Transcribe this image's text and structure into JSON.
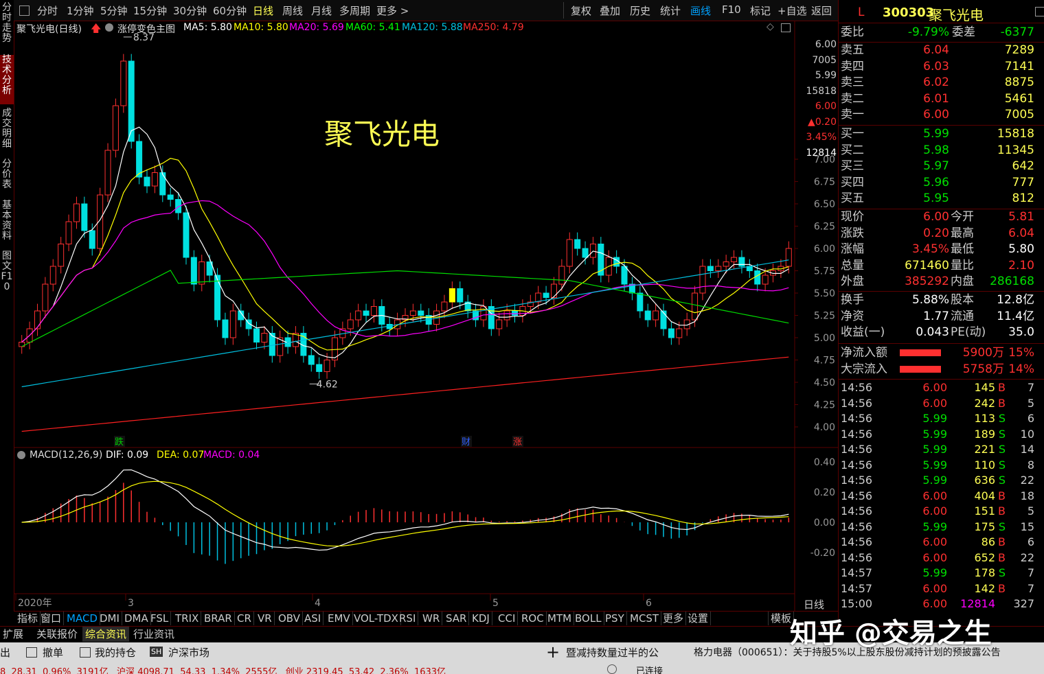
{
  "left_tabs": [
    {
      "label": "分时走势",
      "active": false
    },
    {
      "label": "技术分析",
      "active": true
    },
    {
      "label": "成交明细",
      "active": false
    },
    {
      "label": "分价表",
      "active": false
    },
    {
      "label": "基本资料",
      "active": false
    },
    {
      "label": "图文F10",
      "active": false
    }
  ],
  "toolbar": {
    "periods": [
      "分时",
      "1分钟",
      "5分钟",
      "15分钟",
      "30分钟",
      "60分钟",
      "日线",
      "周线",
      "月线",
      "多周期",
      "更多 >"
    ],
    "active_period": "日线",
    "actions": [
      "复权",
      "叠加",
      "历史",
      "统计",
      "画线",
      "F10",
      "标记",
      "+自选",
      "返回"
    ],
    "active_action": "画线"
  },
  "chart": {
    "title": "聚飞光电(日线)",
    "main_indicator": "涨停变色主图",
    "ma": [
      {
        "label": "MA5: 5.80",
        "color": "#ffffff"
      },
      {
        "label": "MA10: 5.80",
        "color": "#ffff00"
      },
      {
        "label": "MA20: 5.69",
        "color": "#ff00ff"
      },
      {
        "label": "MA60: 5.41",
        "color": "#00ff00"
      },
      {
        "label": "MA120: 5.88",
        "color": "#00c0e0"
      },
      {
        "label": "MA250: 4.79",
        "color": "#ff3030"
      }
    ],
    "watermark_name": "聚飞光电",
    "high_label": "8.37",
    "low_label": "4.62",
    "price_axis": [
      "7.00",
      "6.75",
      "6.50",
      "6.25",
      "6.00",
      "5.75",
      "5.50",
      "5.25",
      "5.00",
      "4.75",
      "4.50",
      "4.25",
      "4.00"
    ],
    "cursor_info": [
      {
        "text": "6.00",
        "color": "#cccccc"
      },
      {
        "text": "7005",
        "color": "#cccccc"
      },
      {
        "text": "5.99",
        "color": "#cccccc"
      },
      {
        "text": "15818",
        "color": "#cccccc"
      },
      {
        "text": "6.00",
        "color": "#ff3030"
      },
      {
        "text": "▲0.20",
        "color": "#ff3030"
      },
      {
        "text": "3.45%",
        "color": "#ff3030"
      },
      {
        "text": "12814",
        "color": "#ffffff"
      }
    ],
    "date_axis": [
      {
        "label": "2020年",
        "pos": "start"
      },
      {
        "label": "3",
        "pos": "mar"
      },
      {
        "label": "4",
        "pos": "apr"
      },
      {
        "label": "5",
        "pos": "may"
      },
      {
        "label": "6",
        "pos": "jun"
      }
    ],
    "period_label": "日线",
    "events": [
      {
        "label": "跌",
        "color": "#00cc00"
      },
      {
        "label": "财",
        "color": "#3060ff"
      },
      {
        "label": "涨",
        "color": "#ff3030"
      }
    ]
  },
  "macd": {
    "title": "MACD(12,26,9)",
    "dif": "DIF: 0.09",
    "dea": "DEA: 0.07",
    "macd": "MACD: 0.04",
    "axis": [
      "0.40",
      "0.20",
      "0.00",
      "-0.20"
    ]
  },
  "indicators": [
    "指标",
    "窗口",
    "MACD",
    "DMI",
    "DMA",
    "FSL",
    "TRIX",
    "BRAR",
    "CR",
    "VR",
    "OBV",
    "ASI",
    "EMV",
    "VOL-TDX",
    "RSI",
    "WR",
    "SAR",
    "KDJ",
    "CCI",
    "ROC",
    "MTM",
    "BOLL",
    "PSY",
    "MCST",
    "更多",
    "设置"
  ],
  "active_indicator": "MACD",
  "template_label": "模板",
  "quote": {
    "code": "300303",
    "name": "聚飞光电",
    "flag": "L",
    "weibi_label": "委比",
    "weibi": "-9.79%",
    "weicha_label": "委差",
    "weicha": "-6377",
    "asks": [
      {
        "label": "卖五",
        "price": "6.04",
        "vol": "7289"
      },
      {
        "label": "卖四",
        "price": "6.03",
        "vol": "7141"
      },
      {
        "label": "卖三",
        "price": "6.02",
        "vol": "8875"
      },
      {
        "label": "卖二",
        "price": "6.01",
        "vol": "5461"
      },
      {
        "label": "卖一",
        "price": "6.00",
        "vol": "7005"
      }
    ],
    "bids": [
      {
        "label": "买一",
        "price": "5.99",
        "vol": "15818"
      },
      {
        "label": "买二",
        "price": "5.98",
        "vol": "11345"
      },
      {
        "label": "买三",
        "price": "5.97",
        "vol": "642"
      },
      {
        "label": "买四",
        "price": "5.96",
        "vol": "777"
      },
      {
        "label": "买五",
        "price": "5.95",
        "vol": "812"
      }
    ],
    "stats1": [
      {
        "l1": "现价",
        "v1": "6.00",
        "c1": "#ff3030",
        "l2": "今开",
        "v2": "5.81",
        "c2": "#ff3030"
      },
      {
        "l1": "涨跌",
        "v1": "0.20",
        "c1": "#ff3030",
        "l2": "最高",
        "v2": "6.04",
        "c2": "#ff3030"
      },
      {
        "l1": "涨幅",
        "v1": "3.45%",
        "c1": "#ff3030",
        "l2": "最低",
        "v2": "5.80",
        "c2": "#ffffff"
      },
      {
        "l1": "总量",
        "v1": "671460",
        "c1": "#ffff54",
        "l2": "量比",
        "v2": "2.10",
        "c2": "#ff3030"
      },
      {
        "l1": "外盘",
        "v1": "385292",
        "c1": "#ff3030",
        "l2": "内盘",
        "v2": "286168",
        "c2": "#00e000"
      }
    ],
    "stats2": [
      {
        "l1": "换手",
        "v1": "5.88%",
        "l2": "股本",
        "v2": "12.8亿"
      },
      {
        "l1": "净资",
        "v1": "1.77",
        "l2": "流通",
        "v2": "11.4亿"
      },
      {
        "l1": "收益(一)",
        "v1": "0.043",
        "l2": "PE(动)",
        "v2": "35.0"
      }
    ],
    "flows": [
      {
        "label": "净流入额",
        "amount": "5900万",
        "pct": "15%"
      },
      {
        "label": "大宗流入",
        "amount": "5758万",
        "pct": "14%"
      }
    ],
    "ticks": [
      {
        "t": "14:56",
        "p": "6.00",
        "v": "145",
        "s": "B",
        "n": "7"
      },
      {
        "t": "14:56",
        "p": "6.00",
        "v": "242",
        "s": "B",
        "n": "5"
      },
      {
        "t": "14:56",
        "p": "5.99",
        "v": "113",
        "s": "S",
        "n": "6"
      },
      {
        "t": "14:56",
        "p": "5.99",
        "v": "189",
        "s": "S",
        "n": "10"
      },
      {
        "t": "14:56",
        "p": "5.99",
        "v": "221",
        "s": "S",
        "n": "14"
      },
      {
        "t": "14:56",
        "p": "5.99",
        "v": "110",
        "s": "S",
        "n": "8"
      },
      {
        "t": "14:56",
        "p": "5.99",
        "v": "636",
        "s": "S",
        "n": "22"
      },
      {
        "t": "14:56",
        "p": "6.00",
        "v": "404",
        "s": "B",
        "n": "18"
      },
      {
        "t": "14:56",
        "p": "6.00",
        "v": "151",
        "s": "B",
        "n": "5"
      },
      {
        "t": "14:56",
        "p": "5.99",
        "v": "175",
        "s": "S",
        "n": "15"
      },
      {
        "t": "14:56",
        "p": "6.00",
        "v": "86",
        "s": "B",
        "n": "6"
      },
      {
        "t": "14:56",
        "p": "6.00",
        "v": "652",
        "s": "B",
        "n": "22"
      },
      {
        "t": "14:57",
        "p": "5.99",
        "v": "178",
        "s": "S",
        "n": "7"
      },
      {
        "t": "14:57",
        "p": "6.00",
        "v": "142",
        "s": "B",
        "n": "7"
      },
      {
        "t": "15:00",
        "p": "6.00",
        "v": "12814",
        "s": "",
        "n": "327"
      }
    ]
  },
  "bottom_tabs": [
    "扩展",
    "关联报价",
    "综合资讯",
    "行业资讯"
  ],
  "active_bottom_tab": "综合资讯",
  "status": {
    "items": [
      "出",
      "撤单",
      "我的持仓",
      "沪深市场"
    ],
    "news": [
      "暨减持数量过半的公",
      "格力电器（000651）：关于持股5%以上股东股份减持计划的预披露公告"
    ],
    "ticker": "8  28.31  0.96%  3191亿   沪深 4098.71  54.33  1.34%  2555亿   创业 2319.45  53.42  2.36%  1633亿",
    "connection": "已连接"
  },
  "watermark": "知乎 @交易之生"
}
